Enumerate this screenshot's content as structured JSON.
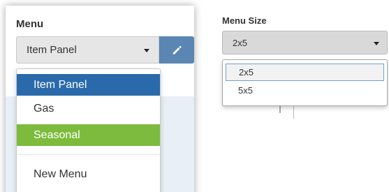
{
  "menu_panel": {
    "label": "Menu",
    "selected": "Item Panel",
    "edit_icon": "pencil-icon",
    "options": [
      {
        "label": "Item Panel",
        "state": "highlighted",
        "color": "#2a6aab"
      },
      {
        "label": "Gas",
        "state": "normal"
      },
      {
        "label": "Seasonal",
        "state": "colored",
        "color": "#7dbb3c"
      },
      {
        "label": "New Menu",
        "state": "normal"
      }
    ]
  },
  "size_panel": {
    "label": "Menu Size",
    "selected": "2x5",
    "options": [
      {
        "label": "2x5",
        "state": "focused"
      },
      {
        "label": "5x5",
        "state": "normal"
      }
    ]
  },
  "colors": {
    "edit_button": "#5b86b3",
    "highlight": "#2a6aab",
    "seasonal": "#7dbb3c"
  }
}
